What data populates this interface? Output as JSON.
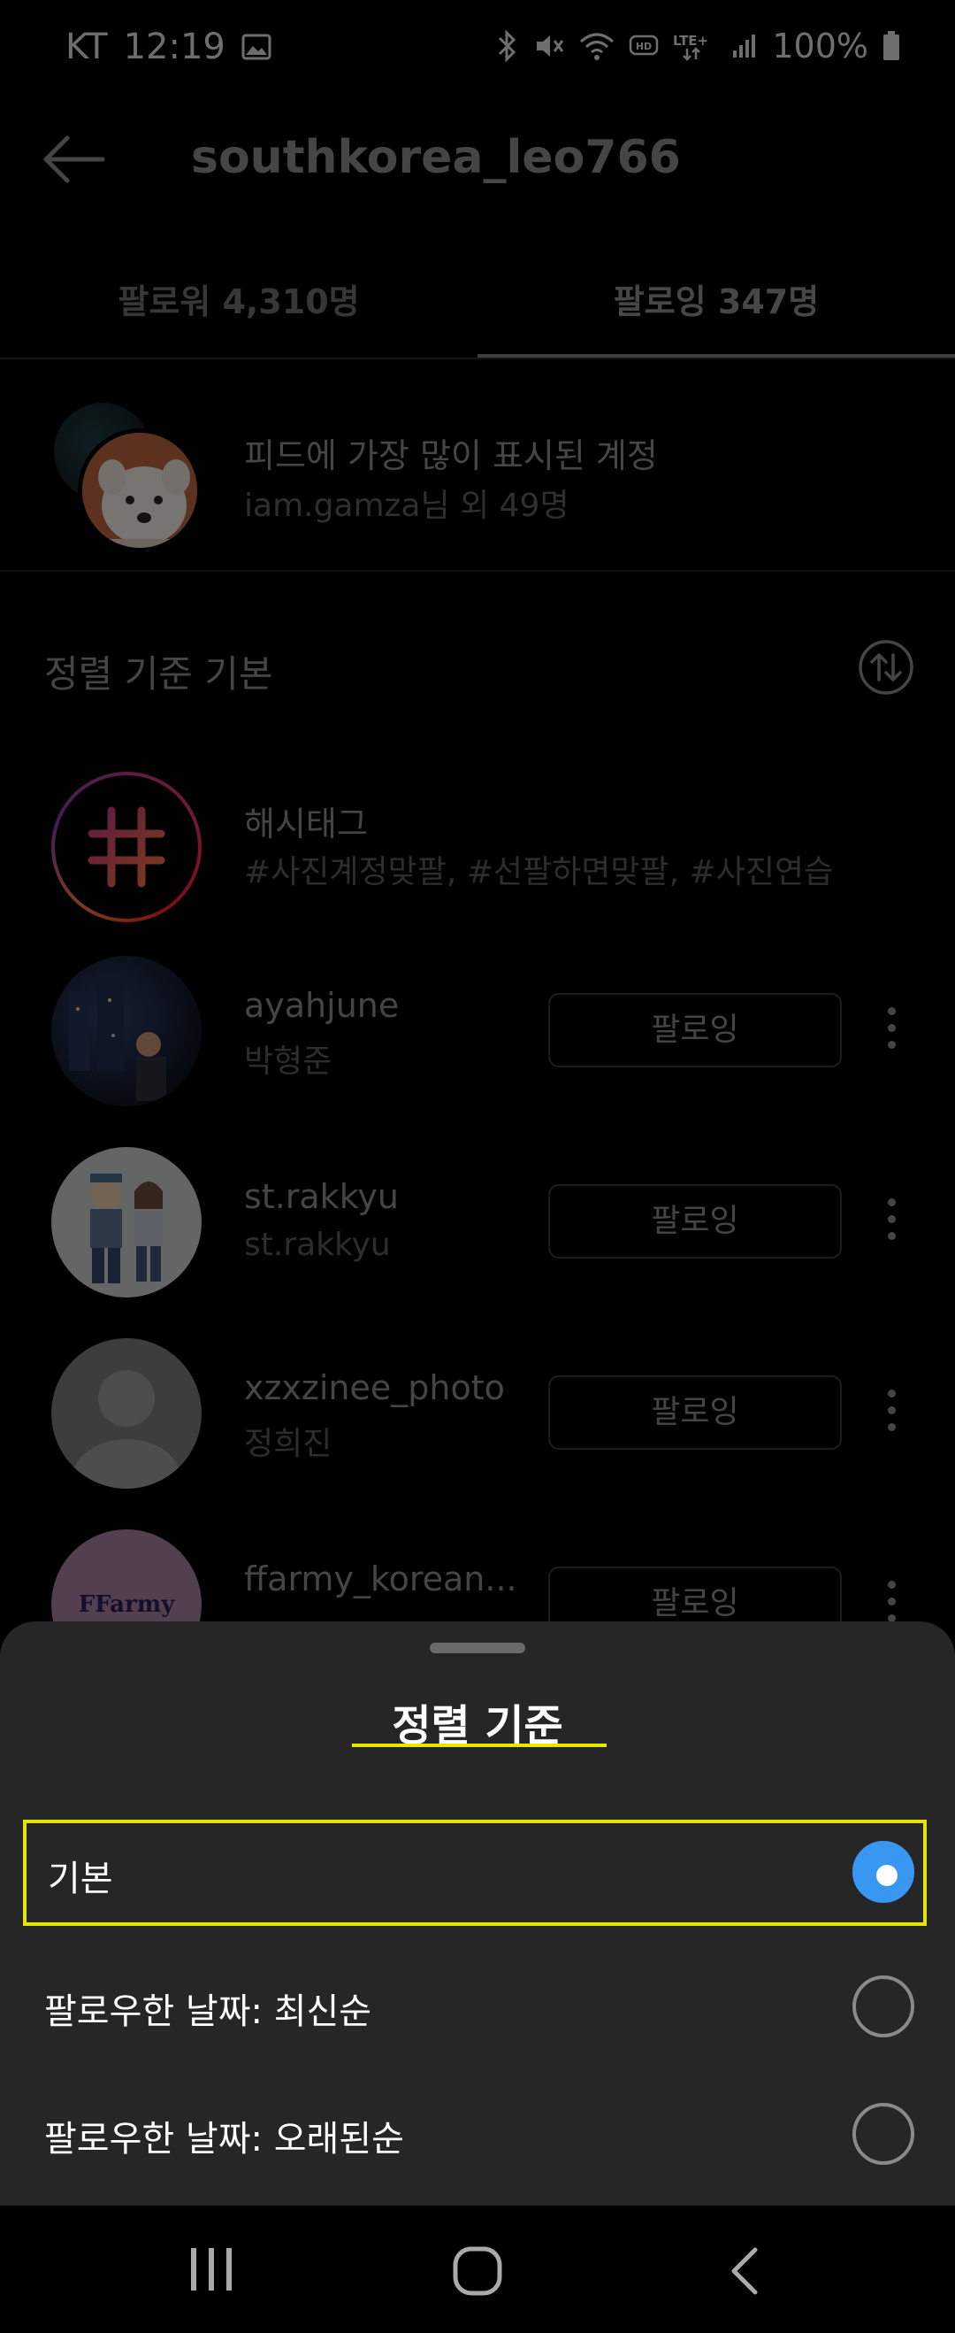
{
  "status_bar": {
    "carrier": "KT",
    "time": "12:19",
    "battery": "100%",
    "icons": [
      "gallery-icon",
      "bluetooth-icon",
      "mute-icon",
      "wifi-icon",
      "hd-icon",
      "lte-icon",
      "signal-icon",
      "battery-icon"
    ]
  },
  "header": {
    "username": "southkorea_leo766"
  },
  "tabs": [
    {
      "label": "팔로워 4,310명",
      "active": false
    },
    {
      "label": "팔로잉 347명",
      "active": true
    }
  ],
  "most_shown": {
    "title": "피드에 가장 많이 표시된 계정",
    "subtitle": "iam.gamza님 외 49명"
  },
  "sort": {
    "label": "정렬 기준 기본"
  },
  "hashtag": {
    "title": "해시태그",
    "tags": "#사진계정맞팔, #선팔하면맞팔, #사진연습"
  },
  "following": [
    {
      "username": "ayahjune",
      "name": "박형준",
      "button": "팔로잉"
    },
    {
      "username": "st.rakkyu",
      "name": "st.rakkyu",
      "button": "팔로잉"
    },
    {
      "username": "xzxzinee_photo",
      "name": "정희진",
      "button": "팔로잉"
    },
    {
      "username": "ffarmy_korean...",
      "name": "",
      "button": "팔로잉",
      "avatar_text": "FFarmy"
    }
  ],
  "sheet": {
    "title": "정렬 기준",
    "options": [
      {
        "label": "기본",
        "selected": true
      },
      {
        "label": "팔로우한 날짜: 최신순",
        "selected": false
      },
      {
        "label": "팔로우한 날짜: 오래된순",
        "selected": false
      }
    ]
  },
  "colors": {
    "accent_blue": "#3897f0",
    "highlight_yellow": "#e6e600",
    "sheet_bg": "#262626"
  }
}
